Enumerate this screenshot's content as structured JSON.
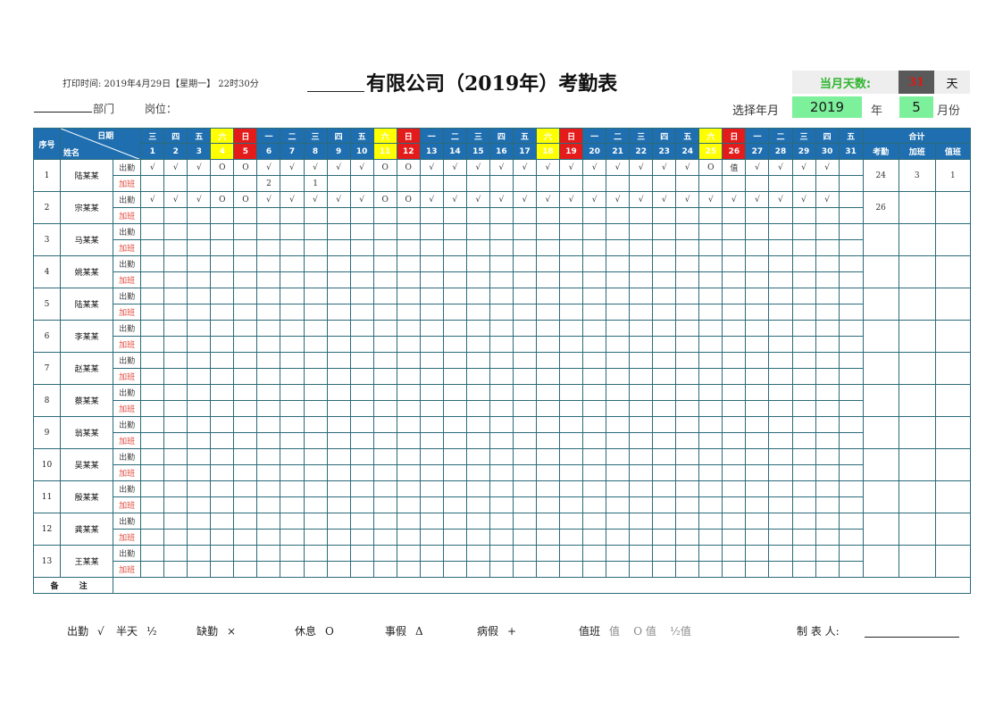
{
  "header": {
    "print_time": "打印时间: 2019年4月29日【星期一】 22时30分",
    "title": "有限公司（2019年）考勤表",
    "days_label": "当月天数:",
    "days_value": "31",
    "days_unit": "天",
    "dept_label": "部门",
    "post_label": "岗位：",
    "ym_label": "选择年月",
    "year": "2019",
    "year_unit": "年",
    "month": "5",
    "month_unit": "月份"
  },
  "table": {
    "seq_header": "序号",
    "diag_top": "日期",
    "diag_bottom": "姓名",
    "total_header": "合计",
    "total_cols": [
      "考勤",
      "加班",
      "值班"
    ],
    "weekdays": [
      "三",
      "四",
      "五",
      "六",
      "日",
      "一",
      "二",
      "三",
      "四",
      "五",
      "六",
      "日",
      "一",
      "二",
      "三",
      "四",
      "五",
      "六",
      "日",
      "一",
      "二",
      "三",
      "四",
      "五",
      "六",
      "日",
      "一",
      "二",
      "三",
      "四",
      "五"
    ],
    "dates": [
      "1",
      "2",
      "3",
      "4",
      "5",
      "6",
      "7",
      "8",
      "9",
      "10",
      "11",
      "12",
      "13",
      "14",
      "15",
      "16",
      "17",
      "18",
      "19",
      "20",
      "21",
      "22",
      "23",
      "24",
      "25",
      "26",
      "27",
      "28",
      "29",
      "30",
      "31"
    ],
    "attend_label": "出勤",
    "overtime_label": "加班",
    "employees": [
      {
        "seq": "1",
        "name": "陆某某",
        "attendance": [
          "√",
          "√",
          "√",
          "O",
          "O",
          "√",
          "√",
          "√",
          "√",
          "√",
          "O",
          "O",
          "√",
          "√",
          "√",
          "√",
          "√",
          "√",
          "√",
          "√",
          "√",
          "√",
          "√",
          "√",
          "O",
          "值",
          "√",
          "√",
          "√",
          "√",
          ""
        ],
        "overtime": [
          "",
          "",
          "",
          "",
          "",
          "2",
          "",
          "1",
          "",
          "",
          "",
          "",
          "",
          "",
          "",
          "",
          "",
          "",
          "",
          "",
          "",
          "",
          "",
          "",
          "",
          "",
          "",
          "",
          "",
          "",
          ""
        ],
        "totals": [
          "24",
          "3",
          "1"
        ]
      },
      {
        "seq": "2",
        "name": "宗某某",
        "attendance": [
          "√",
          "√",
          "√",
          "O",
          "O",
          "√",
          "√",
          "√",
          "√",
          "√",
          "O",
          "O",
          "√",
          "√",
          "√",
          "√",
          "√",
          "√",
          "√",
          "√",
          "√",
          "√",
          "√",
          "√",
          "√",
          "√",
          "√",
          "√",
          "√",
          "√",
          ""
        ],
        "overtime": [
          "",
          "",
          "",
          "",
          "",
          "",
          "",
          "",
          "",
          "",
          "",
          "",
          "",
          "",
          "",
          "",
          "",
          "",
          "",
          "",
          "",
          "",
          "",
          "",
          "",
          "",
          "",
          "",
          "",
          "",
          ""
        ],
        "totals": [
          "26",
          "",
          ""
        ]
      },
      {
        "seq": "3",
        "name": "马某某",
        "totals": [
          "",
          "",
          ""
        ]
      },
      {
        "seq": "4",
        "name": "姚某某",
        "totals": [
          "",
          "",
          ""
        ]
      },
      {
        "seq": "5",
        "name": "陆某某",
        "totals": [
          "",
          "",
          ""
        ]
      },
      {
        "seq": "6",
        "name": "李某某",
        "totals": [
          "",
          "",
          ""
        ]
      },
      {
        "seq": "7",
        "name": "赵某某",
        "totals": [
          "",
          "",
          ""
        ]
      },
      {
        "seq": "8",
        "name": "蔡某某",
        "totals": [
          "",
          "",
          ""
        ]
      },
      {
        "seq": "9",
        "name": "翁某某",
        "totals": [
          "",
          "",
          ""
        ]
      },
      {
        "seq": "10",
        "name": "吴某某",
        "totals": [
          "",
          "",
          ""
        ]
      },
      {
        "seq": "11",
        "name": "殷某某",
        "totals": [
          "",
          "",
          ""
        ]
      },
      {
        "seq": "12",
        "name": "龚某某",
        "totals": [
          "",
          "",
          ""
        ]
      },
      {
        "seq": "13",
        "name": "王某某",
        "totals": [
          "",
          "",
          ""
        ]
      }
    ],
    "remark_label": "备 注"
  },
  "legend": [
    {
      "key": "出勤",
      "symbol": "√"
    },
    {
      "key": "半天",
      "symbol": "½"
    },
    {
      "key": "缺勤",
      "symbol": "×"
    },
    {
      "key": "休息",
      "symbol": "O"
    },
    {
      "key": "事假",
      "symbol": "Δ"
    },
    {
      "key": "病假",
      "symbol": "+"
    },
    {
      "key": "值班",
      "symbol": "值    O 值    ½值"
    }
  ],
  "maker_label": "制 表 人:",
  "colors": {
    "header_blue": "#1f6fb0",
    "saturday": "#ffff00",
    "sunday": "#e41b1b",
    "selector_green": "#7cf09a",
    "grid": "#2a6b7a"
  }
}
